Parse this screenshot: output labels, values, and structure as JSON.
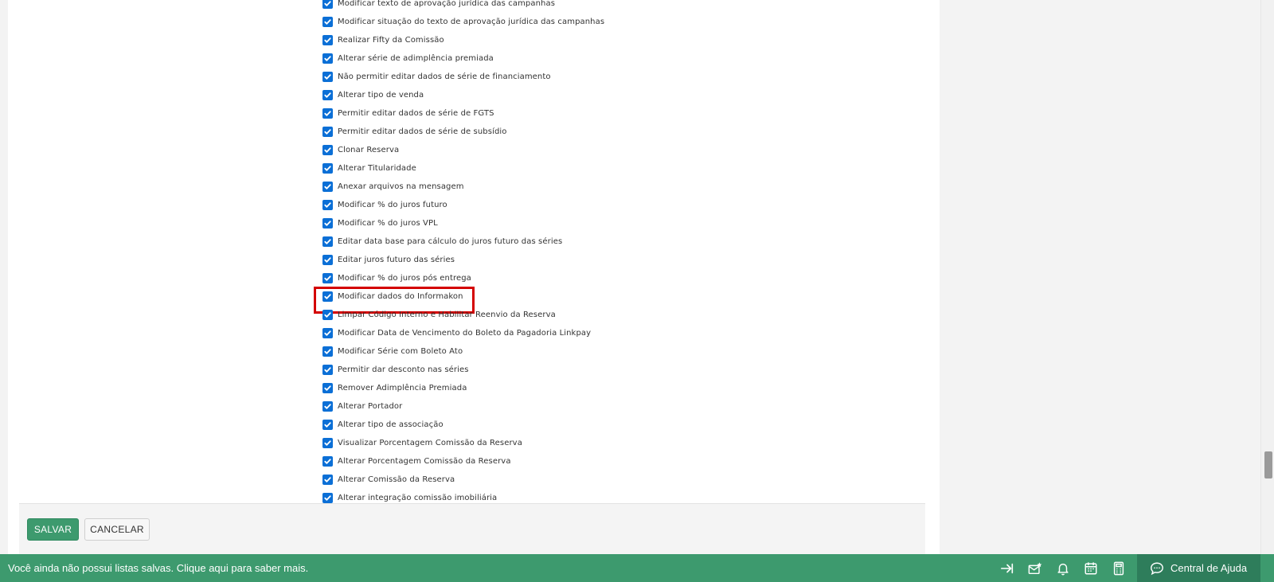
{
  "permissions": [
    {
      "label": "Modificar texto de aprovação jurídica das campanhas",
      "checked": true
    },
    {
      "label": "Modificar situação do texto de aprovação jurídica das campanhas",
      "checked": true
    },
    {
      "label": "Realizar Fifty da Comissão",
      "checked": true
    },
    {
      "label": "Alterar série de adimplência premiada",
      "checked": true
    },
    {
      "label": "Não permitir editar dados de série de financiamento",
      "checked": true
    },
    {
      "label": "Alterar tipo de venda",
      "checked": true
    },
    {
      "label": "Permitir editar dados de série de FGTS",
      "checked": true
    },
    {
      "label": "Permitir editar dados de série de subsídio",
      "checked": true
    },
    {
      "label": "Clonar Reserva",
      "checked": true
    },
    {
      "label": "Alterar Titularidade",
      "checked": true
    },
    {
      "label": "Anexar arquivos na mensagem",
      "checked": true
    },
    {
      "label": "Modificar % do juros futuro",
      "checked": true
    },
    {
      "label": "Modificar % do juros VPL",
      "checked": true
    },
    {
      "label": "Editar data base para cálculo do juros futuro das séries",
      "checked": true
    },
    {
      "label": "Editar juros futuro das séries",
      "checked": true
    },
    {
      "label": "Modificar % do juros pós entrega",
      "checked": true
    },
    {
      "label": "Modificar dados do Informakon",
      "checked": true,
      "highlighted": true
    },
    {
      "label": "Limpar Código Interno e Habilitar Reenvio da Reserva",
      "checked": true
    },
    {
      "label": "Modificar Data de Vencimento do Boleto da Pagadoria Linkpay",
      "checked": true
    },
    {
      "label": "Modificar Série com Boleto Ato",
      "checked": true
    },
    {
      "label": "Permitir dar desconto nas séries",
      "checked": true
    },
    {
      "label": "Remover Adimplência Premiada",
      "checked": true
    },
    {
      "label": "Alterar Portador",
      "checked": true
    },
    {
      "label": "Alterar tipo de associação",
      "checked": true
    },
    {
      "label": "Visualizar Porcentagem Comissão da Reserva",
      "checked": true
    },
    {
      "label": "Alterar Porcentagem Comissão da Reserva",
      "checked": true
    },
    {
      "label": "Alterar Comissão da Reserva",
      "checked": true
    },
    {
      "label": "Alterar integração comissão imobiliária",
      "checked": true
    }
  ],
  "actions": {
    "save_label": "SALVAR",
    "cancel_label": "CANCELAR"
  },
  "status_bar": {
    "message": "Você ainda não possui listas salvas. Clique aqui para saber mais.",
    "help_label": "Central de Ajuda",
    "icons": [
      "collapse-arrow-icon",
      "mail-star-icon",
      "bell-icon",
      "calendar-icon",
      "calculator-icon",
      "chat-help-icon"
    ]
  },
  "colors": {
    "primary_green": "#3d9a6e",
    "help_green": "#2e7d5b",
    "checkbox_blue": "#0b6fd6",
    "highlight_red": "#d40000"
  }
}
